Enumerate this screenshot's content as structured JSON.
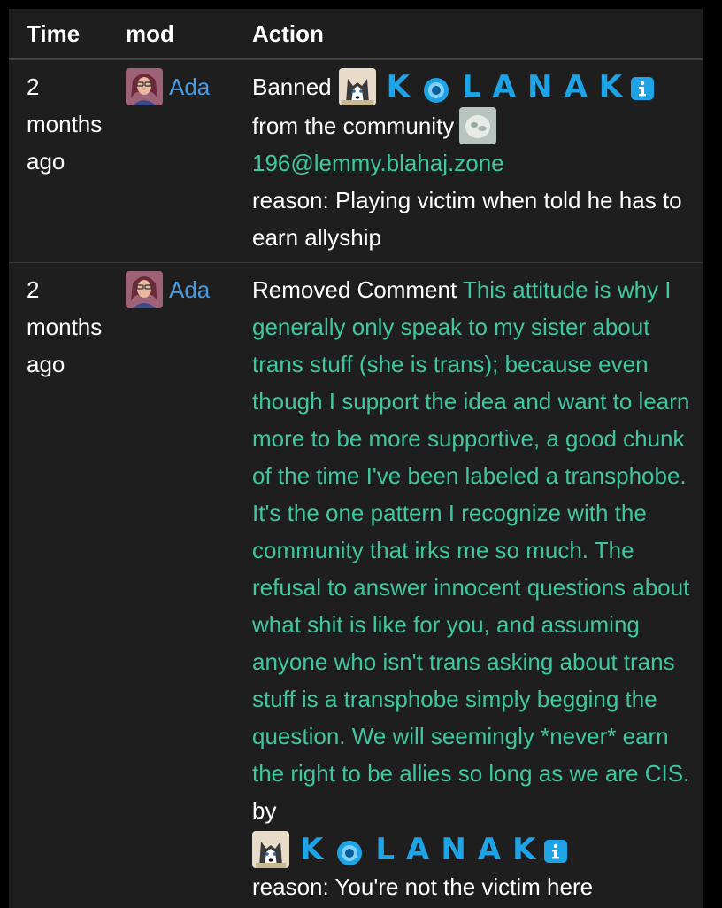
{
  "table": {
    "headers": {
      "time": "Time",
      "mod": "mod",
      "action": "Action"
    }
  },
  "rows": [
    {
      "time": "2 months ago",
      "mod": "Ada",
      "action_verb": "Banned",
      "target_user": "K🔵LANAK",
      "user_name_parts": [
        "K",
        "LANAK"
      ],
      "community_prefix": "from the community",
      "community": "196@lemmy.blahaj.zone",
      "reason": "reason: Playing victim when told he has to earn allyship"
    },
    {
      "time": "2 months ago",
      "mod": "Ada",
      "action_verb": "Removed Comment",
      "comment_text": "This attitude is why I generally only speak to my sister about trans stuff (she is trans); because even though I support the idea and want to learn more to be more supportive, a good chunk of the time I've been labeled a transphobe. It's the one pattern I recognize with the community that irks me so much. The refusal to answer innocent questions about what shit is like for you, and assuming anyone who isn't trans asking about trans stuff is a transphobe simply begging the question. We will seemingly *never* earn the right to be allies so long as we are CIS.",
      "by_label": "by",
      "user_name_parts": [
        "K",
        "LANAK"
      ],
      "reason": "reason: You're not the victim here"
    }
  ],
  "colors": {
    "background": "#1e1e1e",
    "link": "#4a9be0",
    "comment": "#3fc7a0",
    "stylized_name": "#1ea3e6"
  },
  "icons": {
    "mod_avatar": "mod-avatar",
    "user_avatar": "husky-avatar",
    "community_avatar": "community-avatar",
    "blue_dot": "blue-circle-icon",
    "info": "info-icon"
  }
}
